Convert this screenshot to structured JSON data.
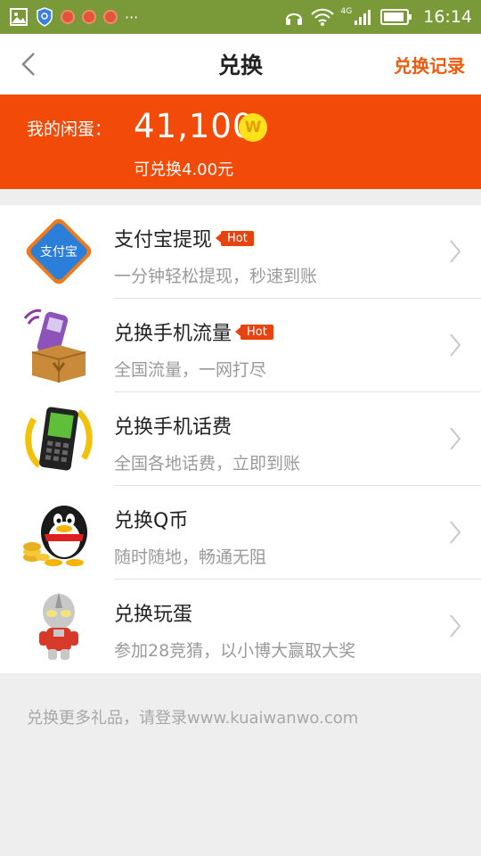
{
  "status_bar": {
    "time": "16:14",
    "network": "4G",
    "icons": [
      "gallery-icon",
      "shield-icon",
      "app-icon",
      "app-icon",
      "app-icon",
      "more-icon",
      "headphones-icon",
      "wifi-icon",
      "signal-icon",
      "battery-icon"
    ]
  },
  "nav": {
    "title": "兑换",
    "right_link": "兑换记录",
    "accent": "#f15a0d"
  },
  "banner": {
    "label": "我的闲蛋：",
    "value": "41,100",
    "coin_symbol": "W",
    "sub": "可兑换4.00元",
    "bg": "#f24a08"
  },
  "items": [
    {
      "title": "支付宝提现",
      "badge": "Hot",
      "desc": "一分钟轻松提现，秒速到账",
      "thumb_text": "支付宝"
    },
    {
      "title": "兑换手机流量",
      "badge": "Hot",
      "desc": "全国流量，一网打尽"
    },
    {
      "title": "兑换手机话费",
      "desc": "全国各地话费，立即到账"
    },
    {
      "title": "兑换Q币",
      "desc": "随时随地，畅通无阻"
    },
    {
      "title": "兑换玩蛋",
      "desc": "参加28竞猜，以小博大赢取大奖"
    }
  ],
  "footer": "兑换更多礼品，请登录www.kuaiwanwo.com"
}
